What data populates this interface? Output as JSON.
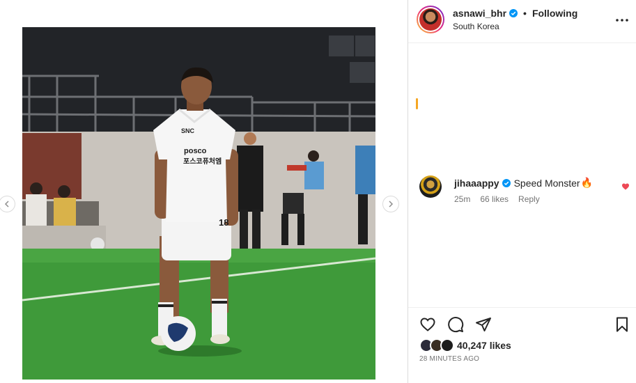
{
  "post": {
    "username": "asnawi_bhr",
    "follow_state": "Following",
    "separator": "•",
    "location": "South Korea",
    "jersey_sponsor_1": "posco",
    "jersey_sponsor_2": "포스코퓨처엠",
    "jersey_number": "18"
  },
  "comment": {
    "username": "jihaaappy",
    "text": "Speed Monster",
    "emoji": "🔥",
    "age": "25m",
    "likes": "66 likes",
    "reply_label": "Reply"
  },
  "footer": {
    "likes": "40,247 likes",
    "timestamp": "28 MINUTES AGO"
  },
  "colors": {
    "verified": "#0095f6",
    "story_ring_start": "#f9ce34",
    "story_ring_end": "#6228d7",
    "heart": "#ed4956",
    "pitch": "#3f9a3a"
  },
  "icons": [
    "chevron-left-icon",
    "chevron-right-icon",
    "verified-badge-icon",
    "more-icon",
    "heart-icon",
    "comment-icon",
    "share-icon",
    "bookmark-icon"
  ]
}
